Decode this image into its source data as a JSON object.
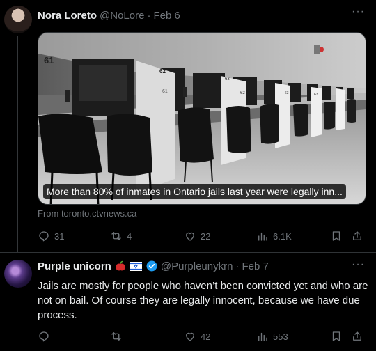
{
  "tweet1": {
    "name": "Nora Loreto",
    "handle": "@NoLore",
    "date": "Feb 6",
    "media_caption": "More than 80% of inmates in Ontario jails last year were legally inn...",
    "source": "From toronto.ctvnews.ca",
    "booth_numbers": [
      "61",
      "62",
      "61",
      "63",
      "62",
      "63",
      "63",
      "64",
      "64",
      "65"
    ],
    "actions": {
      "replies": "31",
      "reposts": "4",
      "likes": "22",
      "views": "6.1K"
    }
  },
  "tweet2": {
    "name": "Purple unicorn",
    "handle": "@Purpleunykrn",
    "date": "Feb 7",
    "text": "Jails are mostly for people who haven’t been convicted yet and who are not on bail. Of course they are legally innocent, because we have due process.",
    "actions": {
      "replies": "",
      "reposts": "",
      "likes": "42",
      "views": "553"
    }
  },
  "colors": {
    "background": "#000000",
    "text": "#e7e9ea",
    "muted": "#71767b",
    "verified": "#1d9bf0",
    "divider": "#2f3336"
  }
}
